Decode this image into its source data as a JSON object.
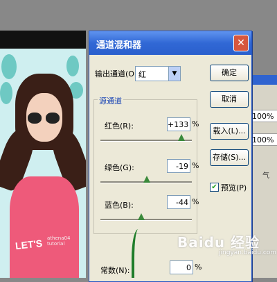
{
  "dialog": {
    "title": "通道混和器",
    "output_label": "输出通道(O):",
    "output_value": "红",
    "group_title": "源通道",
    "channels": [
      {
        "label": "红色(R):",
        "value": "+133",
        "unit": "%",
        "slider_percent": 133
      },
      {
        "label": "绿色(G):",
        "value": "-19",
        "unit": "%",
        "slider_percent": -19
      },
      {
        "label": "蓝色(B):",
        "value": "-44",
        "unit": "%",
        "slider_percent": -44
      }
    ],
    "constant_label": "常数(N):",
    "constant_value": "0",
    "constant_unit": "%",
    "buttons": {
      "ok": "确定",
      "cancel": "取消",
      "load": "载入(L)...",
      "save": "存储(S)..."
    },
    "preview_label": "预览(P)",
    "preview_checked": true,
    "close_icon": "close-icon"
  },
  "photo": {
    "shirt_text": "LET'S",
    "watermark": "athena04 tutorial"
  },
  "panel": {
    "zoom1": "100%",
    "zoom2": "100%",
    "text": "气"
  },
  "watermark": {
    "brand": "Baidu 经验",
    "sub": "jingyan.baidu.com"
  },
  "colors": {
    "title_bar": "#3168d5",
    "dialog_bg": "#ece9d8",
    "close_button": "#d6573f",
    "group_title": "#1a45b5"
  }
}
